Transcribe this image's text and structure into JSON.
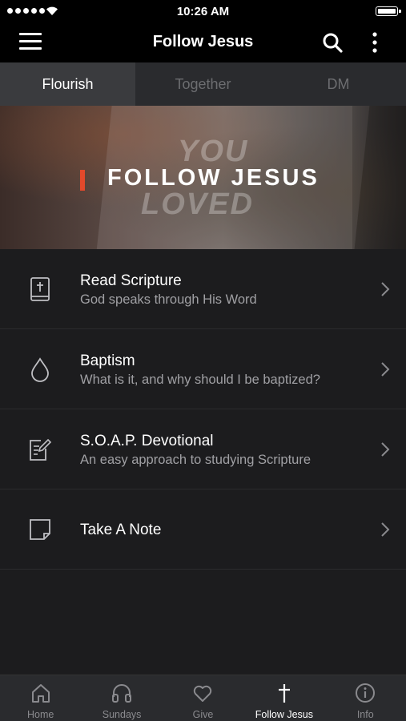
{
  "status_bar": {
    "time": "10:26 AM"
  },
  "nav": {
    "title": "Follow Jesus"
  },
  "tabs": [
    {
      "label": "Flourish",
      "selected": true
    },
    {
      "label": "Together",
      "selected": false
    },
    {
      "label": "DM",
      "selected": false
    }
  ],
  "banner": {
    "title": "FOLLOW JESUS",
    "accent_color": "#e3492b",
    "background_words": [
      "YOU",
      "LOVED"
    ]
  },
  "list": [
    {
      "title": "Read Scripture",
      "subtitle": "God speaks through His Word",
      "icon": "bible-icon"
    },
    {
      "title": "Baptism",
      "subtitle": "What is it, and why should I be baptized?",
      "icon": "water-drop-icon"
    },
    {
      "title": "S.O.A.P. Devotional",
      "subtitle": "An easy approach to studying Scripture",
      "icon": "edit-note-icon"
    },
    {
      "title": "Take A Note",
      "subtitle": "",
      "icon": "note-icon"
    }
  ],
  "tab_bar": [
    {
      "label": "Home",
      "icon": "home-icon",
      "active": false
    },
    {
      "label": "Sundays",
      "icon": "headphones-icon",
      "active": false
    },
    {
      "label": "Give",
      "icon": "heart-icon",
      "active": false
    },
    {
      "label": "Follow Jesus",
      "icon": "cross-icon",
      "active": true
    },
    {
      "label": "Info",
      "icon": "info-icon",
      "active": false
    }
  ]
}
